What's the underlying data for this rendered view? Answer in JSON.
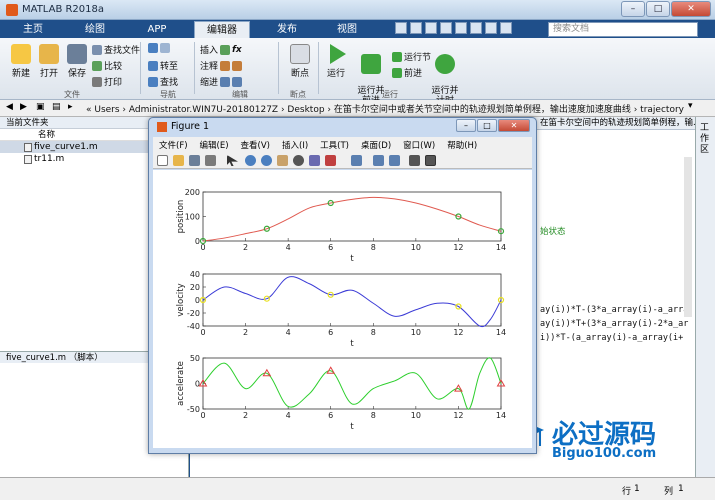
{
  "app": {
    "title": "MATLAB R2018a"
  },
  "window_controls": {
    "minimize": "–",
    "maximize": "□",
    "close": "✕"
  },
  "tabs": [
    "主页",
    "绘图",
    "APP",
    "编辑器",
    "发布",
    "视图"
  ],
  "search_placeholder": "搜索文档",
  "ribbon": {
    "new": "新建",
    "open": "打开",
    "save": "保存",
    "find_files": "查找文件",
    "compare": "比较",
    "print": "打印",
    "goto": "转至",
    "find": "查找",
    "insert": "插入",
    "comment": "注释",
    "indent": "缩进",
    "fx": "fx",
    "breakpoint": "断点",
    "run": "运行",
    "run_advance": "运行并\n前进",
    "run_section": "运行节",
    "advance": "前进",
    "run_time": "运行并\n计时",
    "groups": {
      "file": "文件",
      "navigate": "导航",
      "edit": "编辑",
      "breakpoint": "断点",
      "run": "运行"
    }
  },
  "address": {
    "path": "« Users › Administrator.WIN7U-20180127Z › Desktop › 在笛卡尔空间中或者关节空间中的轨迹规划简单例程，输出速度加速度曲线 › trajectory"
  },
  "left_panel": {
    "title": "当前文件夹",
    "column": "名称",
    "files": [
      "five_curve1.m",
      "tr11.m"
    ],
    "detail": "five_curve1.m （脚本）"
  },
  "editor": {
    "tab_text": "在笛卡尔空间中的轨迹规划简单例程，输...",
    "code_fragment_1": "始状态",
    "code_lines": [
      "ay(i))*T-(3*a_array(i)-a_arra",
      "ay(i))*T+(3*a_array(i)-2*a_ar",
      "i))*T-(a_array(i)-a_array(i+"
    ]
  },
  "right_panel": {
    "title": "工作区"
  },
  "status": {
    "row_label": "行",
    "row": "1",
    "col_label": "列",
    "col": "1"
  },
  "watermark": {
    "brand": "必过源码",
    "site": "Biguo100.com"
  },
  "figure": {
    "title": "Figure 1",
    "menu": [
      "文件(F)",
      "编辑(E)",
      "查看(V)",
      "插入(I)",
      "工具(T)",
      "桌面(D)",
      "窗口(W)",
      "帮助(H)"
    ]
  },
  "chart_data": [
    {
      "type": "line",
      "ylabel": "position",
      "xlabel": "t",
      "xlim": [
        0,
        14
      ],
      "ylim": [
        0,
        200
      ],
      "yticks": [
        0,
        100,
        200
      ],
      "xticks": [
        0,
        2,
        4,
        6,
        8,
        10,
        12,
        14
      ],
      "color": "#e05a50",
      "x": [
        0,
        1,
        2,
        3,
        4,
        5,
        6,
        7,
        8,
        9,
        10,
        11,
        12,
        13,
        14
      ],
      "values": [
        0,
        12,
        30,
        50,
        90,
        135,
        155,
        170,
        178,
        172,
        155,
        130,
        100,
        65,
        40
      ],
      "markers": {
        "x": [
          0,
          3,
          6,
          12,
          14
        ],
        "y": [
          0,
          50,
          155,
          100,
          40
        ],
        "shape": "circle",
        "color": "#3aa83a"
      }
    },
    {
      "type": "line",
      "ylabel": "velocity",
      "xlabel": "t",
      "xlim": [
        0,
        14
      ],
      "ylim": [
        -40,
        40
      ],
      "yticks": [
        -40,
        -20,
        0,
        20,
        40
      ],
      "xticks": [
        0,
        2,
        4,
        6,
        8,
        10,
        12,
        14
      ],
      "color": "#3c3cd6",
      "x": [
        0,
        1,
        2,
        3,
        4,
        5,
        6,
        7,
        8,
        9,
        10,
        11,
        12,
        13,
        13.5,
        14
      ],
      "values": [
        0,
        20,
        10,
        2,
        35,
        25,
        8,
        15,
        -5,
        -25,
        -15,
        -5,
        -10,
        -40,
        -30,
        0
      ],
      "markers": {
        "x": [
          0,
          3,
          6,
          12,
          14
        ],
        "y": [
          0,
          2,
          8,
          -10,
          0
        ],
        "shape": "circle",
        "color": "#e8e020"
      }
    },
    {
      "type": "line",
      "ylabel": "accelerate",
      "xlabel": "t",
      "xlim": [
        0,
        14
      ],
      "ylim": [
        -50,
        50
      ],
      "yticks": [
        -50,
        0,
        50
      ],
      "xticks": [
        0,
        2,
        4,
        6,
        8,
        10,
        12,
        14
      ],
      "color": "#2ecf2e",
      "x": [
        0,
        1,
        2,
        3,
        4,
        5,
        6,
        7,
        8,
        9,
        10,
        11,
        12,
        12.5,
        13,
        13.5,
        14
      ],
      "values": [
        0,
        40,
        -10,
        20,
        -45,
        -20,
        25,
        -40,
        -10,
        5,
        20,
        -30,
        -10,
        -50,
        20,
        60,
        0
      ],
      "markers": {
        "x": [
          0,
          3,
          6,
          12,
          14
        ],
        "y": [
          0,
          20,
          25,
          -10,
          0
        ],
        "shape": "triangle",
        "color": "#e04040"
      }
    }
  ]
}
